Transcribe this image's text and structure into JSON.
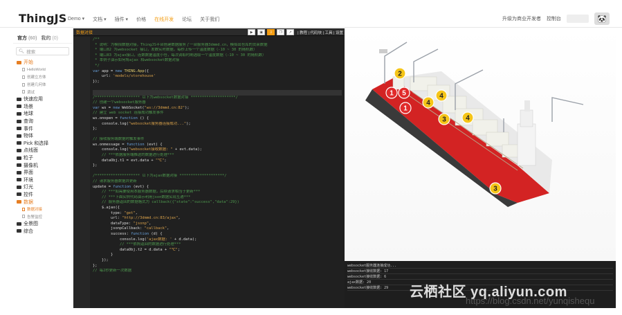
{
  "header": {
    "logo": "ThingJS",
    "nav": [
      "Demo ▾",
      "文档 ▾",
      "插件 ▾",
      "价格",
      "在线开发",
      "论坛",
      "关于我们"
    ],
    "nav_active_index": 4,
    "right": [
      "升级为商业开发者",
      "控制台"
    ],
    "avatar_icon": "panda-avatar"
  },
  "sidebar": {
    "tabs": [
      {
        "label": "官方",
        "count": "(60)"
      },
      {
        "label": "我的",
        "count": "(0)"
      }
    ],
    "search_placeholder": "搜索",
    "tree": [
      {
        "type": "folder",
        "label": "开始",
        "open": true
      },
      {
        "type": "leaf",
        "label": "HelloWorld"
      },
      {
        "type": "leaf",
        "label": "创建立方体"
      },
      {
        "type": "leaf",
        "label": "创建几何体"
      },
      {
        "type": "leaf",
        "label": "调试"
      },
      {
        "type": "folder",
        "label": "快速应用"
      },
      {
        "type": "folder",
        "label": "场景"
      },
      {
        "type": "folder",
        "label": "地球"
      },
      {
        "type": "folder",
        "label": "查询"
      },
      {
        "type": "folder",
        "label": "事件"
      },
      {
        "type": "folder",
        "label": "物体"
      },
      {
        "type": "folder",
        "label": "Pick 和选择"
      },
      {
        "type": "folder",
        "label": "点线面"
      },
      {
        "type": "folder",
        "label": "粒子"
      },
      {
        "type": "folder",
        "label": "摄像机"
      },
      {
        "type": "folder",
        "label": "界面"
      },
      {
        "type": "folder",
        "label": "环境"
      },
      {
        "type": "folder",
        "label": "灯光"
      },
      {
        "type": "folder",
        "label": "控件"
      },
      {
        "type": "folder",
        "label": "数据",
        "open": true
      },
      {
        "type": "leaf",
        "label": "数据对接",
        "active": true
      },
      {
        "type": "leaf",
        "label": "告警监控"
      },
      {
        "type": "folder",
        "label": "全景图"
      },
      {
        "type": "folder",
        "label": "综合"
      }
    ]
  },
  "editor": {
    "title": "数据对接",
    "toolbar_links": "| 教程 | 代码块 | 工具 | 设置",
    "toolbar_buttons": [
      "run-icon",
      "save-icon",
      "download-icon",
      "copy-icon",
      "share-icon"
    ],
    "code": [
      [
        1,
        [
          [
            "cm",
            "/**"
          ]
        ]
      ],
      [
        2,
        [
          [
            "cm",
            " * 说明：为模拟数据对接，ThingJS平台搭建数据服务了一台服务器3dmmd.cn，模拟出仓库的货架数据"
          ]
        ]
      ],
      [
        3,
        [
          [
            "cm",
            " * 端口82 为websocket 接口，发数实时数据，每秒上传一个温度数据（-10 ~ 30 的随机数）"
          ]
        ]
      ],
      [
        4,
        [
          [
            "cm",
            " * 端口83 为ajax接口，连数数据温度小仓，每次调取时刷选取一个温度数据（-10 ~ 30 的随机数）"
          ]
        ]
      ],
      [
        5,
        [
          [
            "cm",
            " * 本例子演示如何将ajax 和websocket数据对接"
          ]
        ]
      ],
      [
        6,
        [
          [
            "cm",
            " */"
          ]
        ]
      ],
      [
        7,
        [
          [
            "kw",
            "var "
          ],
          [
            "tx",
            "app = "
          ],
          [
            "kw",
            "new "
          ],
          [
            "ud",
            "THING.App"
          ],
          [
            "tx",
            "({"
          ]
        ]
      ],
      [
        8,
        [
          [
            "tx",
            "    url: "
          ],
          [
            "st",
            "'models/storehouse'"
          ]
        ]
      ],
      [
        9,
        [
          [
            "tx",
            "});"
          ]
        ]
      ],
      [
        10,
        [
          [
            "tx",
            ""
          ]
        ]
      ],
      [
        11,
        [
          [
            "tx",
            ""
          ]
        ]
      ],
      [
        12,
        [
          [
            "cm",
            "/******************** 以下为websocket数据对接 ********************/"
          ]
        ]
      ],
      [
        13,
        [
          [
            "cm",
            "// 创建一个websocket服务器"
          ]
        ]
      ],
      [
        14,
        [
          [
            "kw",
            "var "
          ],
          [
            "tx",
            "ws = "
          ],
          [
            "kw",
            "new "
          ],
          [
            "tx",
            "WebSocket("
          ],
          [
            "st",
            "\"ws://3dmmd.cn:82\""
          ],
          [
            "tx",
            ");"
          ]
        ]
      ],
      [
        15,
        [
          [
            "cm",
            "// 建立 web socket 连接成功触发事件"
          ]
        ]
      ],
      [
        16,
        [
          [
            "tx",
            "ws.onopen = "
          ],
          [
            "kw",
            "function "
          ],
          [
            "tx",
            "() {"
          ]
        ]
      ],
      [
        17,
        [
          [
            "tx",
            "    console.log("
          ],
          [
            "st",
            "\"websocket服务器连接成功...\""
          ],
          [
            "tx",
            ");"
          ]
        ]
      ],
      [
        18,
        [
          [
            "tx",
            "};"
          ]
        ]
      ],
      [
        19,
        [
          [
            "tx",
            ""
          ]
        ]
      ],
      [
        20,
        [
          [
            "cm",
            "// 接收服务端数据时触发事件"
          ]
        ]
      ],
      [
        21,
        [
          [
            "tx",
            "ws.onmessage = "
          ],
          [
            "kw",
            "function "
          ],
          [
            "tx",
            "(evt) {"
          ]
        ]
      ],
      [
        22,
        [
          [
            "tx",
            "    console.log("
          ],
          [
            "st",
            "\"websocket接收数据: \""
          ],
          [
            "tx",
            " + evt.data);"
          ]
        ]
      ],
      [
        23,
        [
          [
            "cm",
            "    // ***依据服务端推送的数据进行处理***"
          ]
        ]
      ],
      [
        24,
        [
          [
            "tx",
            "    dataObj.t1 = evt.data + "
          ],
          [
            "st",
            "\"℃\""
          ],
          [
            "tx",
            ";"
          ]
        ]
      ],
      [
        25,
        [
          [
            "tx",
            "};"
          ]
        ]
      ],
      [
        26,
        [
          [
            "tx",
            ""
          ]
        ]
      ],
      [
        27,
        [
          [
            "cm",
            "/******************** 以下为ajax数据对接 ********************/"
          ]
        ]
      ],
      [
        28,
        [
          [
            "cm",
            "// 请求服务器数据并更新"
          ]
        ]
      ],
      [
        29,
        [
          [
            "tx",
            "update = "
          ],
          [
            "kw",
            "function "
          ],
          [
            "tx",
            "(evt) {"
          ]
        ]
      ],
      [
        30,
        [
          [
            "cm",
            "    // ***如需要使用本服务器数据，后续请求相当于更新***"
          ]
        ]
      ],
      [
        31,
        [
          [
            "cm",
            "    // ***下面实例代码演示利用json数据实现互通***"
          ]
        ]
      ],
      [
        32,
        [
          [
            "cm",
            "    // 服务器返回的数据格式为 callback({\"state\":\"success\",\"data\":29})"
          ]
        ]
      ],
      [
        33,
        [
          [
            "tx",
            "    $.ajax({"
          ]
        ]
      ],
      [
        34,
        [
          [
            "tx",
            "        type: "
          ],
          [
            "st",
            "\"get\""
          ],
          [
            "tx",
            ","
          ]
        ]
      ],
      [
        35,
        [
          [
            "tx",
            "        url: "
          ],
          [
            "st",
            "\"http://3dmmd.cn:83/ajax\""
          ],
          [
            "tx",
            ","
          ]
        ]
      ],
      [
        36,
        [
          [
            "tx",
            "        dataType: "
          ],
          [
            "st",
            "\"jsonp\""
          ],
          [
            "tx",
            ","
          ]
        ]
      ],
      [
        37,
        [
          [
            "tx",
            "        jsonpCallback: "
          ],
          [
            "st",
            "\"callback\""
          ],
          [
            "tx",
            ","
          ]
        ]
      ],
      [
        38,
        [
          [
            "tx",
            "        success: "
          ],
          [
            "kw",
            "function "
          ],
          [
            "tx",
            "(d) {"
          ]
        ]
      ],
      [
        39,
        [
          [
            "tx",
            "            console.log("
          ],
          [
            "st",
            "'ajax数据: '"
          ],
          [
            "tx",
            " + d.data);"
          ]
        ]
      ],
      [
        40,
        [
          [
            "cm",
            "            // ***依照返回的数据进行处理***"
          ]
        ]
      ],
      [
        41,
        [
          [
            "tx",
            "            dataObj.t2 = d.data + "
          ],
          [
            "st",
            "\"℃\""
          ],
          [
            "tx",
            ";"
          ]
        ]
      ],
      [
        42,
        [
          [
            "tx",
            "        }"
          ]
        ]
      ],
      [
        43,
        [
          [
            "tx",
            "    });"
          ]
        ]
      ],
      [
        44,
        [
          [
            "tx",
            "};"
          ]
        ]
      ],
      [
        45,
        [
          [
            "cm",
            "// 每2秒更新一次数据"
          ]
        ]
      ]
    ]
  },
  "viewport": {
    "markers": [
      {
        "label": "2",
        "color": "#f5c518"
      },
      {
        "label": "1",
        "color": "#e12b2b"
      },
      {
        "label": "5",
        "color": "#e12b2b"
      },
      {
        "label": "4",
        "color": "#f5c518"
      },
      {
        "label": "4",
        "color": "#f5c518"
      },
      {
        "label": "1",
        "color": "#e12b2b"
      },
      {
        "label": "3",
        "color": "#f5c518"
      },
      {
        "label": "4",
        "color": "#f5c518"
      },
      {
        "label": "3",
        "color": "#f5c518"
      }
    ]
  },
  "log": [
    "websocket服务器连接成功...",
    "websocket接收数据: 17",
    "websocket接收数据: 6",
    "ajax数据: 20",
    "websocket接收数据: 29"
  ],
  "watermarks": {
    "main": "云栖社区 yq.aliyun.com",
    "url": "https://blog.csdn.net/yunqishequ"
  },
  "colors": {
    "accent": "#f39c12",
    "editor_bg": "#202020",
    "hull_red": "#d32323"
  }
}
